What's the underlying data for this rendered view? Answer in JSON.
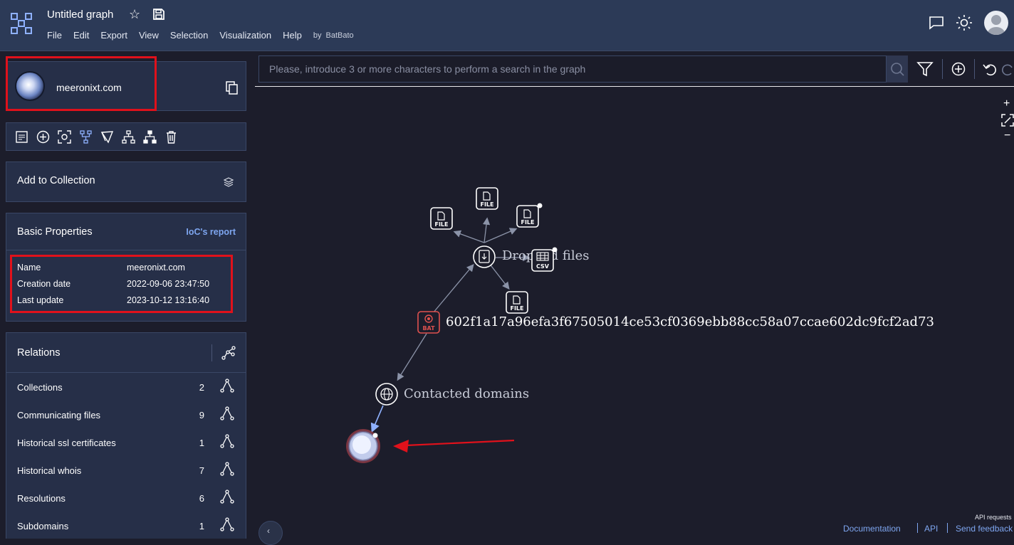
{
  "app": {
    "title": "Untitled graph",
    "menu": [
      "File",
      "Edit",
      "Export",
      "View",
      "Selection",
      "Visualization",
      "Help"
    ],
    "by_label": "by",
    "by_user": "BatBato"
  },
  "entity": {
    "name": "meeronixt.com"
  },
  "collection": {
    "label": "Add to Collection"
  },
  "basic_properties": {
    "title": "Basic Properties",
    "ioc_link": "IoC's report",
    "rows": [
      {
        "key": "Name",
        "value": "meeronixt.com"
      },
      {
        "key": "Creation date",
        "value": "2022-09-06 23:47:50"
      },
      {
        "key": "Last update",
        "value": "2023-10-12 13:16:40"
      }
    ]
  },
  "relations": {
    "title": "Relations",
    "rows": [
      {
        "label": "Collections",
        "count": "2"
      },
      {
        "label": "Communicating files",
        "count": "9"
      },
      {
        "label": "Historical ssl certificates",
        "count": "1"
      },
      {
        "label": "Historical whois",
        "count": "7"
      },
      {
        "label": "Resolutions",
        "count": "6"
      },
      {
        "label": "Subdomains",
        "count": "1"
      }
    ]
  },
  "search": {
    "placeholder": "Please, introduce 3 or more characters to perform a search in the graph"
  },
  "graph": {
    "labels": {
      "dropped": "Dropped files",
      "hash": "602f1a17a96efa3f67505014ce53cf0369ebb88cc58a07ccae602dc9fcf2ad73",
      "contacted": "Contacted domains"
    },
    "node_tags": {
      "file": "FILE",
      "csv": "CSV",
      "bat": "BAT"
    }
  },
  "footer": {
    "api_requests": "API requests",
    "links": [
      "Documentation",
      "API",
      "Send feedback"
    ]
  },
  "colors": {
    "accent_link": "#7ea6f0",
    "highlight": "#e0111b",
    "bat_node": "#e0524f"
  }
}
